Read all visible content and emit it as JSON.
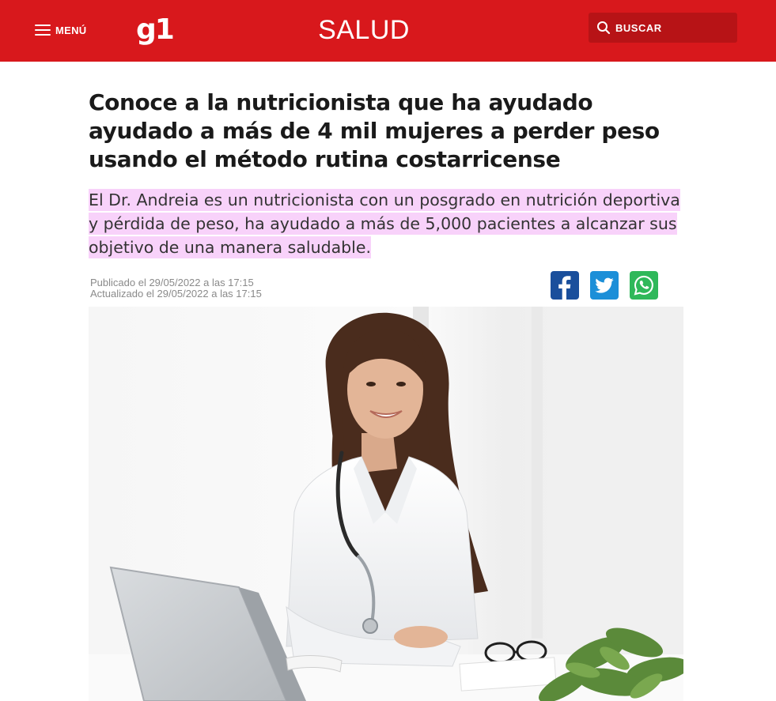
{
  "header": {
    "menu_label": "MENÚ",
    "logo_text": "g1",
    "section": "SALUD",
    "search_label": "BUSCAR",
    "background_color": "#d8181c"
  },
  "article": {
    "headline": "Conoce a la nutricionista que ha ayudado ayudado a más de 4 mil mujeres a perder peso usando el método rutina costarricense",
    "subheadline": "El Dr. Andreia es un nutricionista con un posgrado en nutrición deportiva y pérdida de peso, ha ayudado a más de 5,000 pacientes a alcanzar sus objetivo de una manera saludable.",
    "highlight_color": "#f8d2fa",
    "published": "Publicado el 29/05/2022 a las 17:15",
    "updated": "Actualizado el 29/05/2022 a las 17:15"
  },
  "share": [
    {
      "network": "facebook",
      "icon": "facebook-icon",
      "color": "#1a4f9c"
    },
    {
      "network": "twitter",
      "icon": "twitter-icon",
      "color": "#1c8fd8"
    },
    {
      "network": "whatsapp",
      "icon": "whatsapp-icon",
      "color": "#2fb85a"
    }
  ],
  "photo": {
    "subject": "smiling-doctor-photo"
  }
}
